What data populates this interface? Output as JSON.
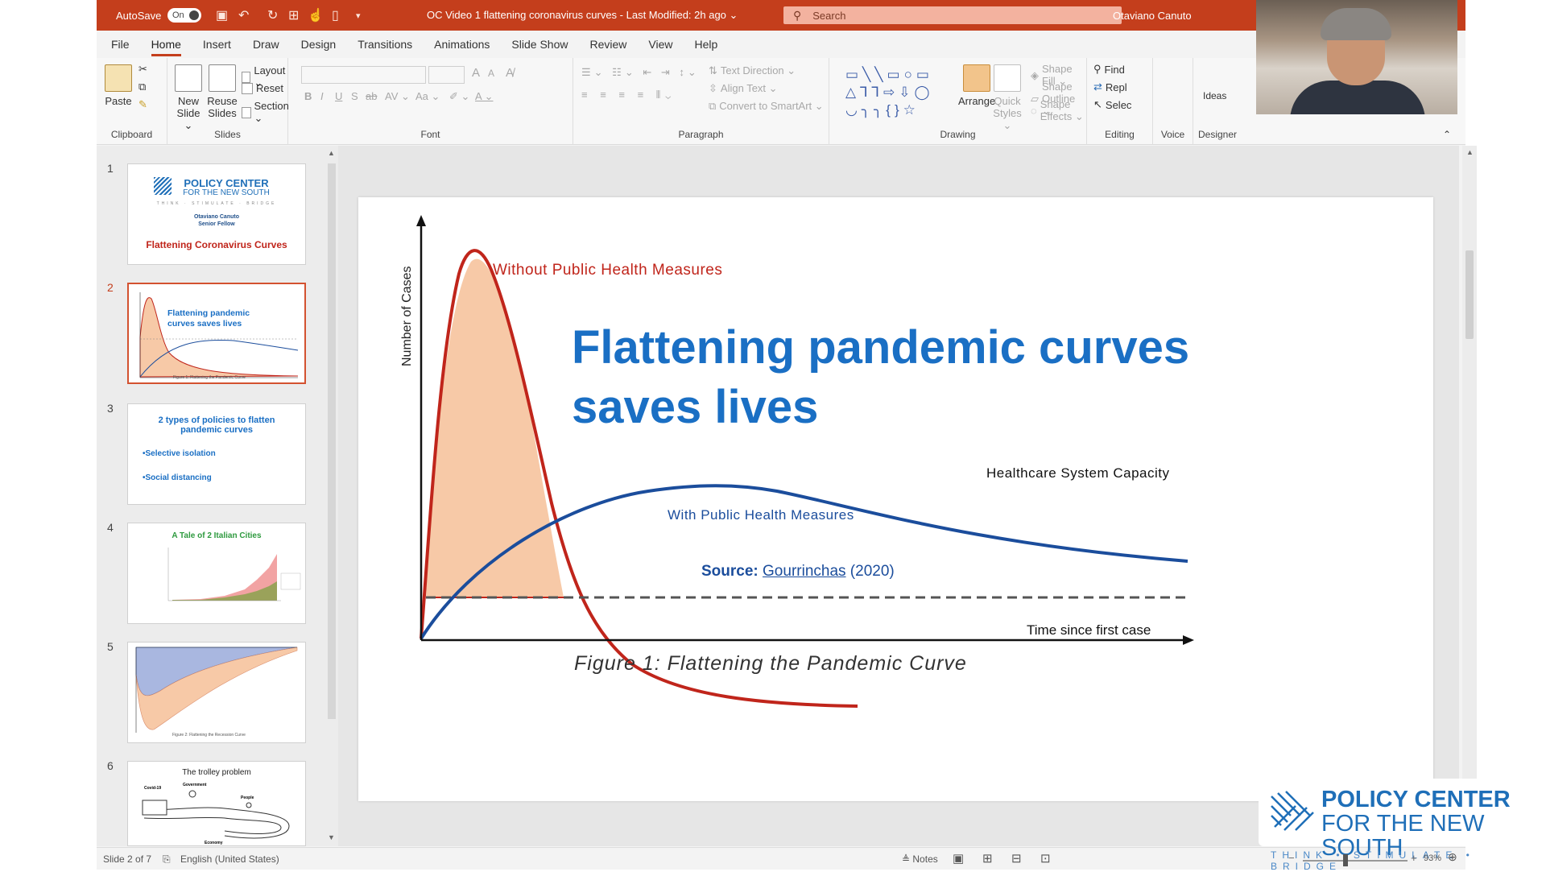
{
  "titlebar": {
    "autosave_label": "AutoSave",
    "autosave_state": "On",
    "doc_title": "OC Video 1 flattening coronavirus curves  -  Last Modified: 2h ago  ⌄",
    "search_placeholder": "Search",
    "user_name": "Otaviano Canuto"
  },
  "tabs": [
    "File",
    "Home",
    "Insert",
    "Draw",
    "Design",
    "Transitions",
    "Animations",
    "Slide Show",
    "Review",
    "View",
    "Help"
  ],
  "ribbon": {
    "clipboard": {
      "paste": "Paste",
      "label": "Clipboard"
    },
    "slides": {
      "new_slide": "New Slide ⌄",
      "reuse_slides": "Reuse Slides",
      "layout": "Layout ⌄",
      "reset": "Reset",
      "section": "Section ⌄",
      "label": "Slides"
    },
    "font": {
      "label": "Font",
      "bold": "B",
      "italic": "I",
      "underline": "U",
      "strike": "S",
      "grow": "A",
      "shrink": "A",
      "case": "Aa ⌄",
      "spacing": "AV ⌄"
    },
    "paragraph": {
      "text_direction": "Text Direction ⌄",
      "align_text": "Align Text ⌄",
      "smartart": "Convert to SmartArt ⌄",
      "label": "Paragraph"
    },
    "drawing": {
      "arrange": "Arrange",
      "quick_styles": "Quick Styles ⌄",
      "shape_fill": "Shape Fill ⌄",
      "shape_outline": "Shape Outline ⌄",
      "shape_effects": "Shape Effects ⌄",
      "label": "Drawing",
      "shapes": "▭╲╲▭○▭ △⅂⅂⇨⇩◯ ◡╮╮{}☆"
    },
    "editing": {
      "find": "Find",
      "replace": "Repl",
      "select": "Selec",
      "label": "Editing"
    },
    "voice": {
      "label": "Voice"
    },
    "designer": {
      "ideas": "Ideas",
      "label": "Designer"
    }
  },
  "thumbnails": [
    {
      "num": "1",
      "logo_l1": "POLICY CENTER",
      "logo_l2": "FOR THE NEW SOUTH",
      "tagline": "THINK · STIMULATE · BRIDGE",
      "author": "Otaviano Canuto",
      "role": "Senior Fellow",
      "title": "Flattening Coronavirus Curves"
    },
    {
      "num": "2",
      "title": "Flattening pandemic curves saves lives",
      "caption": "Figure 1: Flattening the Pandemic Curve"
    },
    {
      "num": "3",
      "title": "2 types of policies to flatten pandemic curves",
      "b1": "•Selective isolation",
      "b2": "•Social distancing"
    },
    {
      "num": "4",
      "title": "A Tale of 2 Italian Cities"
    },
    {
      "num": "5",
      "caption": "Figure 2: Flattening the Recession Curve"
    },
    {
      "num": "6",
      "title": "The trolley problem",
      "l_covid": "Covid-19",
      "l_gov": "Government",
      "l_people": "People",
      "l_econ": "Economy"
    }
  ],
  "slide": {
    "title_line1": "Flattening pandemic curves",
    "title_line2": "saves lives",
    "without_label": "Without Public Health Measures",
    "capacity_label": "Healthcare System Capacity",
    "with_label": "With Public Health Measures",
    "source_prefix": "Source: ",
    "source_link": "Gourrinchas",
    "source_year": " (2020)",
    "y_axis_label": "Number of Cases",
    "x_axis_label": "Time since first case",
    "caption": "Figure 1: Flattening the Pandemic Curve",
    "colors": {
      "red": "#c0251b",
      "blue": "#1b4d9c",
      "title_blue": "#1a6fc4",
      "fill": "#f7c9a7"
    }
  },
  "statusbar": {
    "slide_info": "Slide 2 of 7",
    "language": "English (United States)",
    "notes": "Notes",
    "zoom": "93%"
  },
  "overlay_logo": {
    "line1": "POLICY CENTER",
    "line2": "FOR THE NEW SOUTH",
    "tagline": "THINK • STIMULATE • BRIDGE"
  }
}
